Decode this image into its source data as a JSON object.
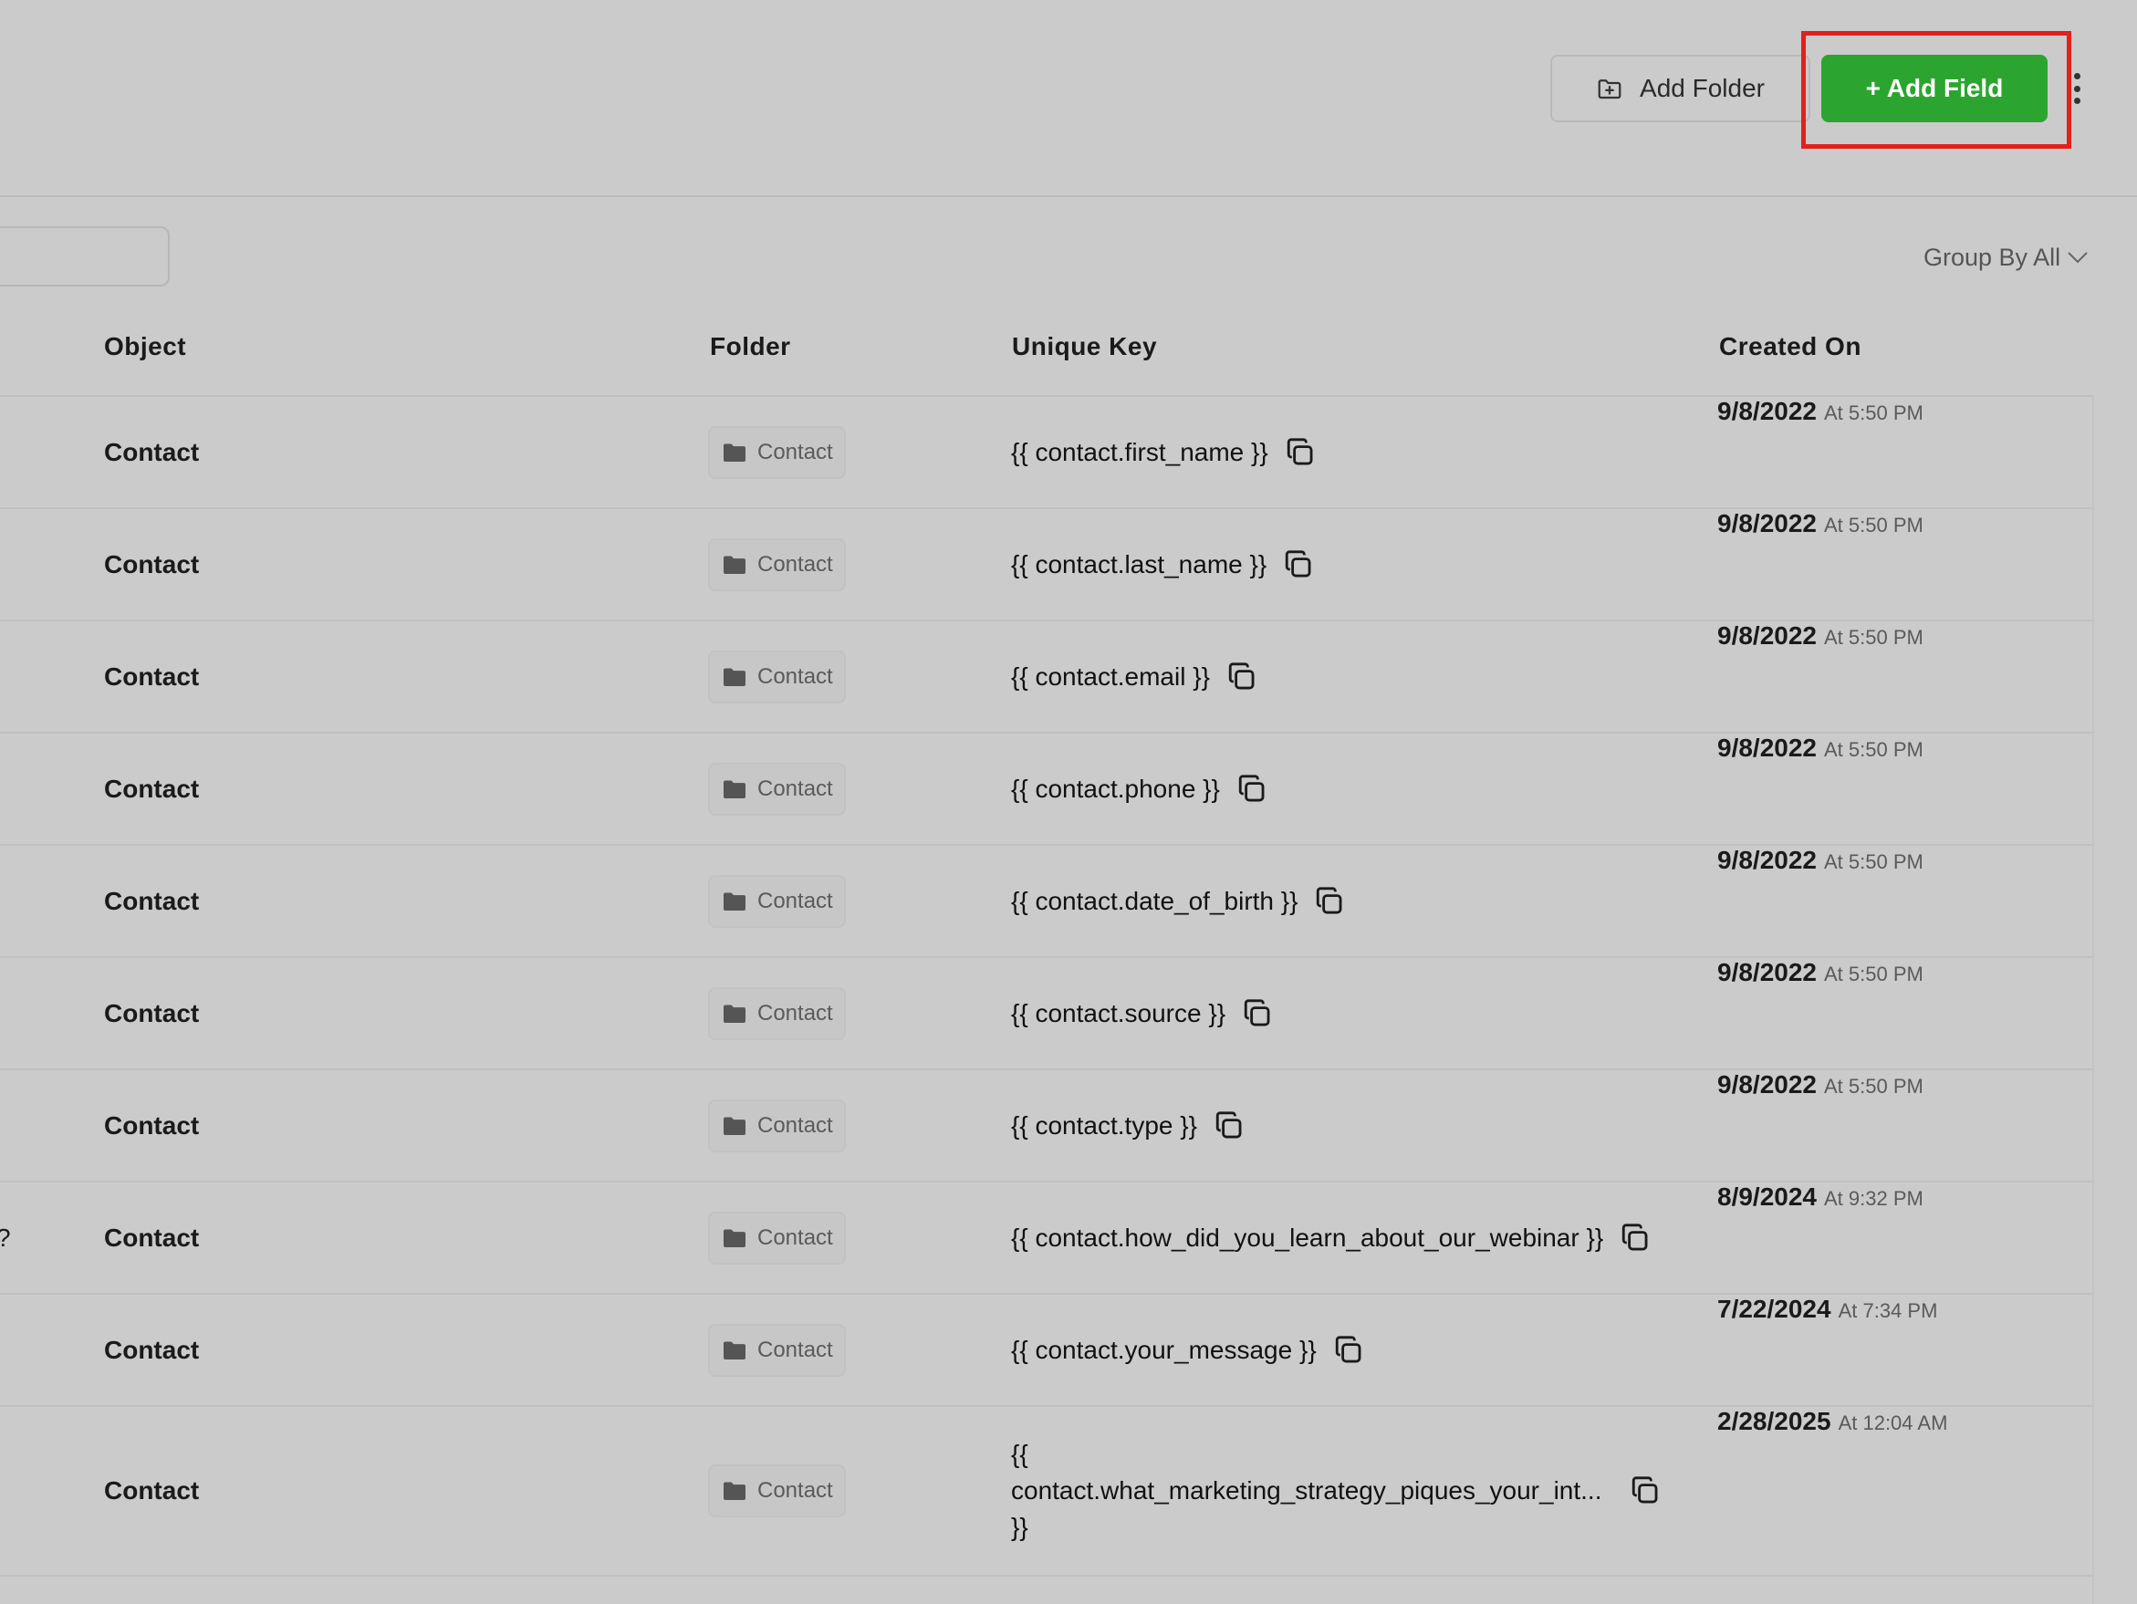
{
  "header": {
    "add_folder_label": "Add Folder",
    "add_field_label": "+ Add Field"
  },
  "toolbar": {
    "group_by_label": "Group By All"
  },
  "table": {
    "columns": [
      "Object",
      "Folder",
      "Unique Key",
      "Created On"
    ],
    "rows": [
      {
        "edge": "",
        "object": "Contact",
        "folder": "Contact",
        "key": "{{ contact.first_name }}",
        "date": "9/8/2022",
        "time": "At 5:50 PM"
      },
      {
        "edge": "",
        "object": "Contact",
        "folder": "Contact",
        "key": "{{ contact.last_name }}",
        "date": "9/8/2022",
        "time": "At 5:50 PM"
      },
      {
        "edge": "",
        "object": "Contact",
        "folder": "Contact",
        "key": "{{ contact.email }}",
        "date": "9/8/2022",
        "time": "At 5:50 PM"
      },
      {
        "edge": "",
        "object": "Contact",
        "folder": "Contact",
        "key": "{{ contact.phone }}",
        "date": "9/8/2022",
        "time": "At 5:50 PM"
      },
      {
        "edge": "",
        "object": "Contact",
        "folder": "Contact",
        "key": "{{ contact.date_of_birth }}",
        "date": "9/8/2022",
        "time": "At 5:50 PM"
      },
      {
        "edge": "",
        "object": "Contact",
        "folder": "Contact",
        "key": "{{ contact.source }}",
        "date": "9/8/2022",
        "time": "At 5:50 PM"
      },
      {
        "edge": "",
        "object": "Contact",
        "folder": "Contact",
        "key": "{{ contact.type }}",
        "date": "9/8/2022",
        "time": "At 5:50 PM"
      },
      {
        "edge": "?",
        "object": "Contact",
        "folder": "Contact",
        "key": "{{ contact.how_did_you_learn_about_our_webinar }}",
        "date": "8/9/2024",
        "time": "At 9:32 PM"
      },
      {
        "edge": "",
        "object": "Contact",
        "folder": "Contact",
        "key": "{{ contact.your_message }}",
        "date": "7/22/2024",
        "time": "At 7:34 PM"
      },
      {
        "edge": "",
        "object": "Contact",
        "folder": "Contact",
        "key_lines": [
          "{{",
          "contact.what_marketing_strategy_piques_your_int...",
          "}}"
        ],
        "date": "2/28/2025",
        "time": "At 12:04 AM"
      }
    ]
  }
}
